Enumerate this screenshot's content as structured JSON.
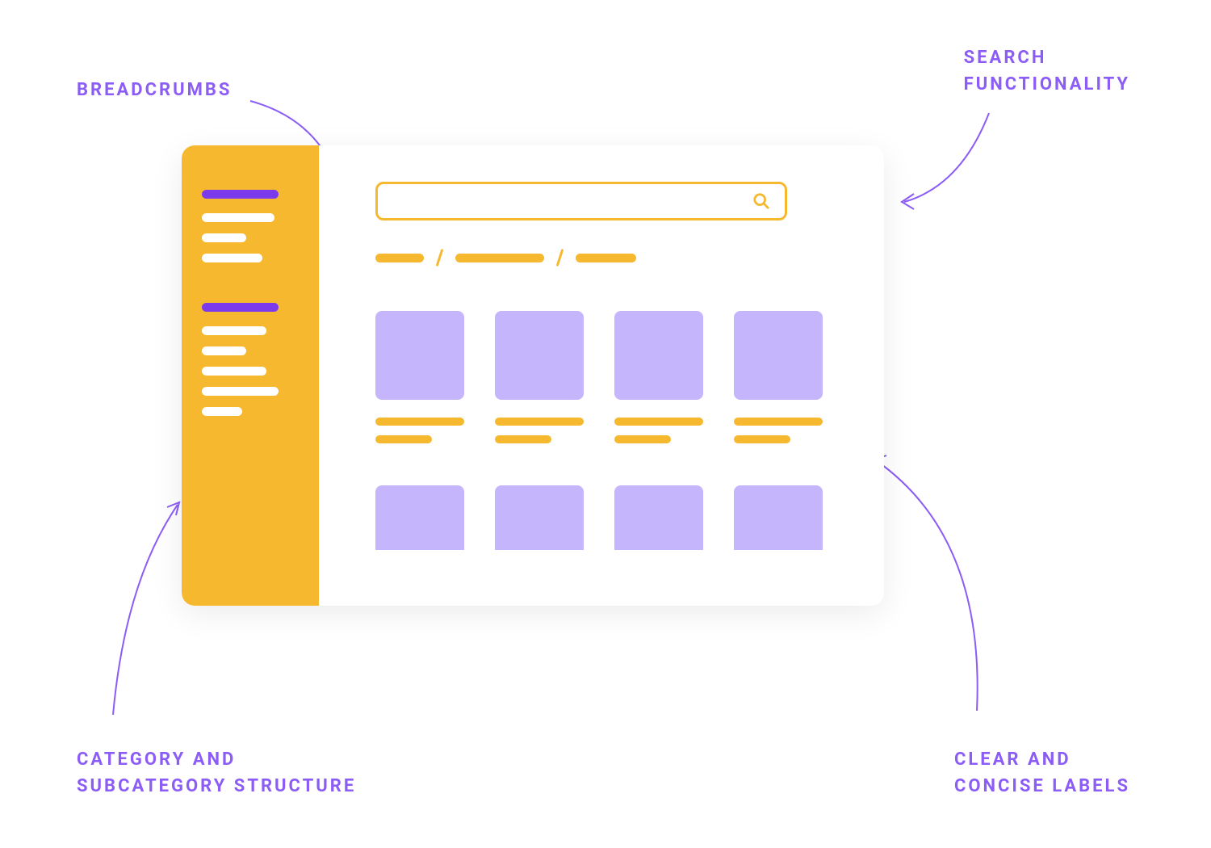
{
  "annotations": {
    "breadcrumbs": "BREADCRUMBS",
    "search": "SEARCH\nFUNCTIONALITY",
    "category": "CATEGORY AND\nSUBCATEGORY STRUCTURE",
    "labels": "CLEAR AND\nCONCISE LABELS"
  },
  "colors": {
    "purple": "#8b5cf6",
    "purple_light": "#c4b5fd",
    "purple_dark": "#7c3aed",
    "orange": "#f5b82e",
    "white": "#ffffff"
  }
}
